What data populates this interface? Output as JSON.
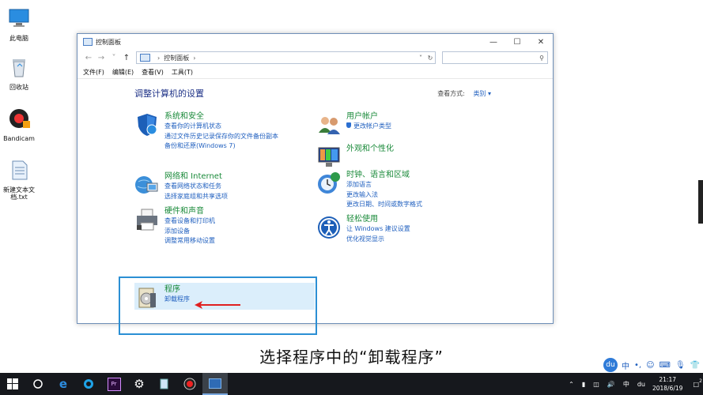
{
  "desktop": {
    "icons": [
      {
        "label": "此电脑",
        "icon": "computer-icon"
      },
      {
        "label": "回收站",
        "icon": "recycle-bin-icon"
      },
      {
        "label": "Bandicam",
        "icon": "bandicam-icon"
      },
      {
        "label": "新建文本文档.txt",
        "icon": "text-file-icon"
      }
    ]
  },
  "window": {
    "title": "控制面板",
    "address": {
      "breadcrumb_item": "控制面板"
    },
    "menu": [
      "文件(F)",
      "编辑(E)",
      "查看(V)",
      "工具(T)"
    ],
    "heading": "调整计算机的设置",
    "view_by": {
      "label": "查看方式:",
      "value": "类别"
    },
    "categories_left": [
      {
        "title": "系统和安全",
        "icon": "security-shield-icon",
        "links": [
          {
            "text": "查看你的计算机状态"
          },
          {
            "text": "通过文件历史记录保存你的文件备份副本"
          },
          {
            "text": "备份和还原(Windows 7)"
          }
        ]
      },
      {
        "title": "网络和 Internet",
        "icon": "network-globe-icon",
        "links": [
          {
            "text": "查看网络状态和任务"
          },
          {
            "text": "选择家庭组和共享选项"
          }
        ]
      },
      {
        "title": "硬件和声音",
        "icon": "printer-icon",
        "links": [
          {
            "text": "查看设备和打印机"
          },
          {
            "text": "添加设备"
          },
          {
            "text": "调整常用移动设置"
          }
        ]
      },
      {
        "title": "程序",
        "icon": "programs-disc-icon",
        "links": [
          {
            "text": "卸载程序"
          }
        ]
      }
    ],
    "categories_right": [
      {
        "title": "用户帐户",
        "icon": "users-icon",
        "links": [
          {
            "text": "更改帐户类型",
            "shield": true
          }
        ]
      },
      {
        "title": "外观和个性化",
        "icon": "appearance-monitor-icon",
        "links": []
      },
      {
        "title": "时钟、语言和区域",
        "icon": "clock-globe-icon",
        "links": [
          {
            "text": "添加语言"
          },
          {
            "text": "更改输入法"
          },
          {
            "text": "更改日期、时间或数字格式"
          }
        ]
      },
      {
        "title": "轻松使用",
        "icon": "ease-of-access-icon",
        "links": [
          {
            "text": "让 Windows 建议设置"
          },
          {
            "text": "优化视觉显示"
          }
        ]
      }
    ]
  },
  "caption": "选择程序中的“卸载程序”",
  "ime": {
    "du": "du",
    "lang": "中"
  },
  "taskbar": {
    "apps": [
      "windows-start-icon",
      "cortana-icon",
      "edge-icon",
      "browser-icon",
      "premiere-icon",
      "settings-gear-icon",
      "notepad-icon",
      "record-icon",
      "control-panel-icon"
    ],
    "active_index": 8,
    "tray_lang": "中",
    "time": "21:17",
    "date": "2018/6/19",
    "notification_count": "2"
  },
  "colors": {
    "accent": "#2b8fd4",
    "category_title": "#1a8a3a",
    "link": "#1f5fbf",
    "heading": "#1e3287",
    "arrow": "#e02020"
  }
}
